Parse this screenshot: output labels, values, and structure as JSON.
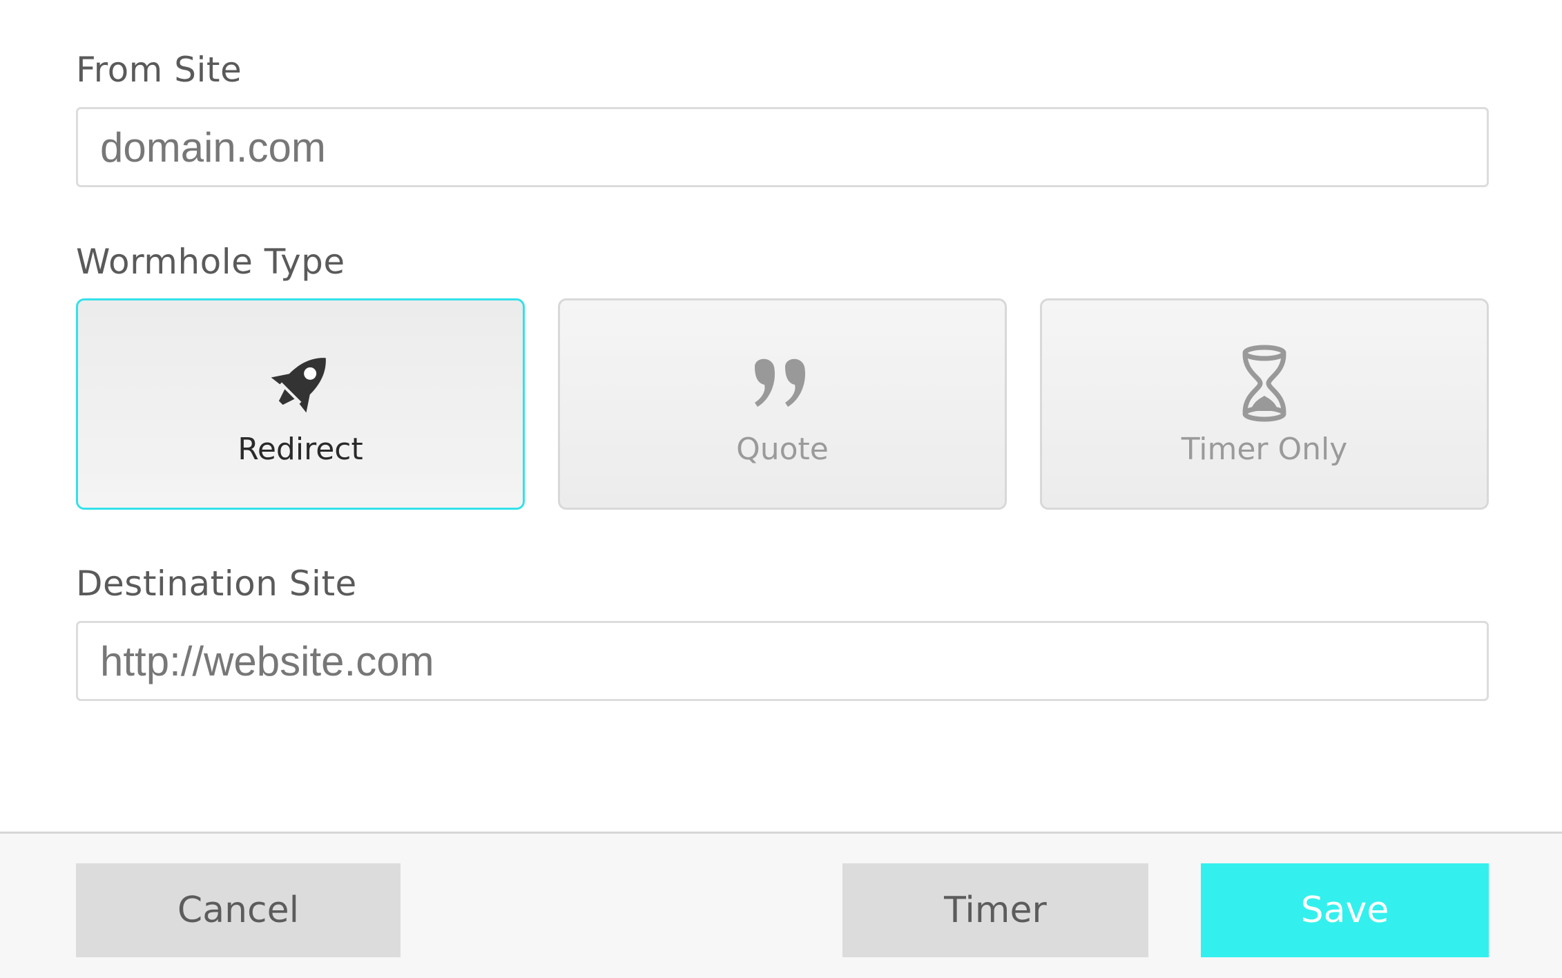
{
  "form": {
    "from_site": {
      "label": "From Site",
      "placeholder": "domain.com",
      "value": ""
    },
    "wormhole_type": {
      "label": "Wormhole Type",
      "selected": "Redirect",
      "options": [
        {
          "label": "Redirect",
          "icon": "rocket-icon"
        },
        {
          "label": "Quote",
          "icon": "quote-icon"
        },
        {
          "label": "Timer Only",
          "icon": "hourglass-icon"
        }
      ]
    },
    "destination_site": {
      "label": "Destination Site",
      "placeholder": "http://website.com",
      "value": ""
    }
  },
  "footer": {
    "cancel_label": "Cancel",
    "timer_label": "Timer",
    "save_label": "Save"
  },
  "colors": {
    "accent": "#33f0ee",
    "selected_border": "#33e1ea",
    "button_grey": "#dcdcdc",
    "footer_bg": "#f7f7f7"
  }
}
